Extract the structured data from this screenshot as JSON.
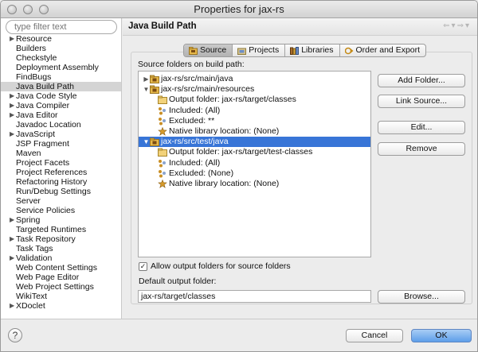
{
  "window": {
    "title": "Properties for jax-rs"
  },
  "sidebar": {
    "filter_placeholder": "type filter text",
    "items": [
      {
        "label": "Resource",
        "expandable": true
      },
      {
        "label": "Builders",
        "expandable": false
      },
      {
        "label": "Checkstyle",
        "expandable": false
      },
      {
        "label": "Deployment Assembly",
        "expandable": false
      },
      {
        "label": "FindBugs",
        "expandable": false
      },
      {
        "label": "Java Build Path",
        "expandable": false,
        "selected": true
      },
      {
        "label": "Java Code Style",
        "expandable": true
      },
      {
        "label": "Java Compiler",
        "expandable": true
      },
      {
        "label": "Java Editor",
        "expandable": true
      },
      {
        "label": "Javadoc Location",
        "expandable": false
      },
      {
        "label": "JavaScript",
        "expandable": true
      },
      {
        "label": "JSP Fragment",
        "expandable": false
      },
      {
        "label": "Maven",
        "expandable": false
      },
      {
        "label": "Project Facets",
        "expandable": false
      },
      {
        "label": "Project References",
        "expandable": false
      },
      {
        "label": "Refactoring History",
        "expandable": false
      },
      {
        "label": "Run/Debug Settings",
        "expandable": false
      },
      {
        "label": "Server",
        "expandable": false
      },
      {
        "label": "Service Policies",
        "expandable": false
      },
      {
        "label": "Spring",
        "expandable": true
      },
      {
        "label": "Targeted Runtimes",
        "expandable": false
      },
      {
        "label": "Task Repository",
        "expandable": true
      },
      {
        "label": "Task Tags",
        "expandable": false
      },
      {
        "label": "Validation",
        "expandable": true
      },
      {
        "label": "Web Content Settings",
        "expandable": false
      },
      {
        "label": "Web Page Editor",
        "expandable": false
      },
      {
        "label": "Web Project Settings",
        "expandable": false
      },
      {
        "label": "WikiText",
        "expandable": false
      },
      {
        "label": "XDoclet",
        "expandable": true
      }
    ]
  },
  "panel": {
    "title": "Java Build Path",
    "tabs": [
      {
        "label": "Source",
        "icon": "source-icon",
        "active": true
      },
      {
        "label": "Projects",
        "icon": "projects-icon",
        "active": false
      },
      {
        "label": "Libraries",
        "icon": "libraries-icon",
        "active": false
      },
      {
        "label": "Order and Export",
        "icon": "order-export-icon",
        "active": false
      }
    ],
    "source_label": "Source folders on build path:",
    "tree": [
      {
        "label": "jax-rs/src/main/java",
        "depth": 0,
        "toggle": "collapsed",
        "icon": "package-folder-icon"
      },
      {
        "label": "jax-rs/src/main/resources",
        "depth": 0,
        "toggle": "expanded",
        "icon": "package-folder-icon"
      },
      {
        "label": "Output folder: jax-rs/target/classes",
        "depth": 1,
        "toggle": "none",
        "icon": "folder-icon"
      },
      {
        "label": "Included: (All)",
        "depth": 1,
        "toggle": "none",
        "icon": "filter-icon"
      },
      {
        "label": "Excluded: **",
        "depth": 1,
        "toggle": "none",
        "icon": "filter-icon"
      },
      {
        "label": "Native library location: (None)",
        "depth": 1,
        "toggle": "none",
        "icon": "native-lib-icon"
      },
      {
        "label": "jax-rs/src/test/java",
        "depth": 0,
        "toggle": "expanded",
        "icon": "package-folder-icon",
        "selected": true
      },
      {
        "label": "Output folder: jax-rs/target/test-classes",
        "depth": 1,
        "toggle": "none",
        "icon": "folder-icon"
      },
      {
        "label": "Included: (All)",
        "depth": 1,
        "toggle": "none",
        "icon": "filter-icon"
      },
      {
        "label": "Excluded: (None)",
        "depth": 1,
        "toggle": "none",
        "icon": "filter-icon"
      },
      {
        "label": "Native library location: (None)",
        "depth": 1,
        "toggle": "none",
        "icon": "native-lib-icon"
      }
    ],
    "buttons": {
      "add_folder": "Add Folder...",
      "link_source": "Link Source...",
      "edit": "Edit...",
      "remove": "Remove",
      "browse": "Browse..."
    },
    "allow_output_label": "Allow output folders for source folders",
    "allow_output_checked": true,
    "default_output_label": "Default output folder:",
    "default_output_value": "jax-rs/target/classes"
  },
  "footer": {
    "cancel": "Cancel",
    "ok": "OK",
    "help": "?"
  },
  "colors": {
    "selection": "#3875d7",
    "primary_button": "#5e9ee9"
  }
}
